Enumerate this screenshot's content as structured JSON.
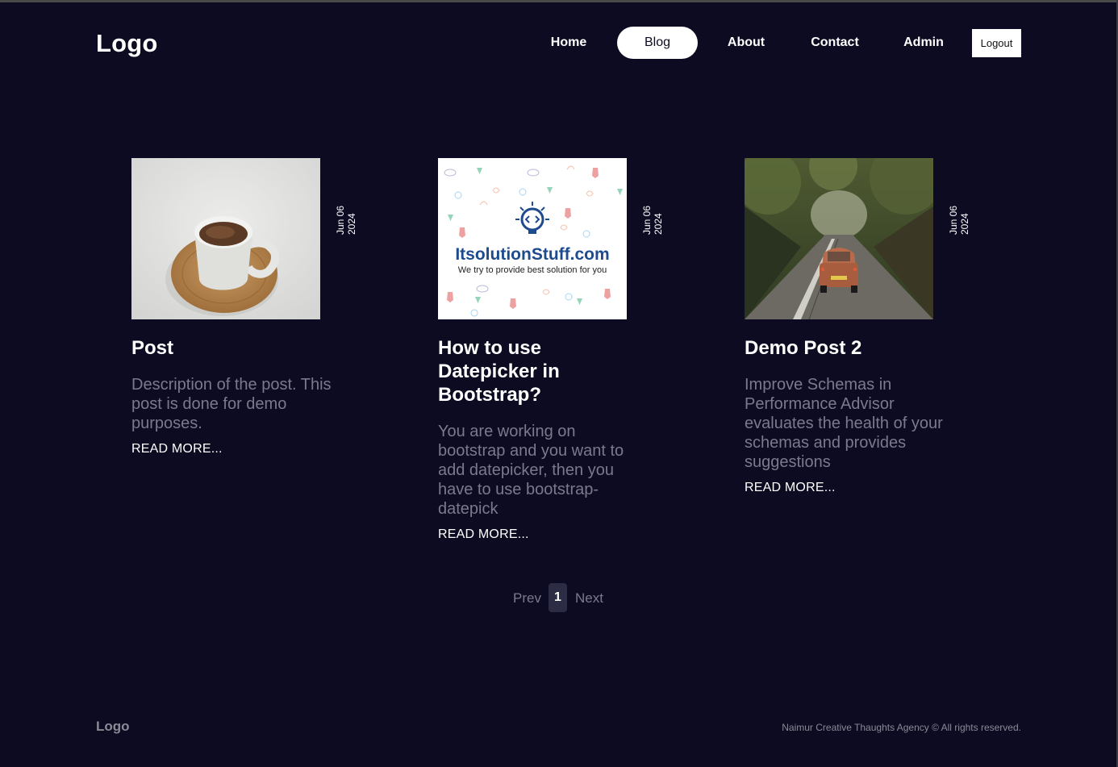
{
  "header": {
    "logo": "Logo",
    "nav": [
      {
        "label": "Home",
        "active": false
      },
      {
        "label": "Blog",
        "active": true
      },
      {
        "label": "About",
        "active": false
      },
      {
        "label": "Contact",
        "active": false
      },
      {
        "label": "Admin",
        "active": false
      }
    ],
    "logout_label": "Logout"
  },
  "posts": [
    {
      "title": "Post",
      "date_month_day": "Jun 06",
      "date_year": "2024",
      "description": "Description of the post. This post is done for demo purposes.",
      "read_more": "READ MORE...",
      "image": "coffee-cup-photo"
    },
    {
      "title": "How to use Datepicker in Bootstrap?",
      "date_month_day": "Jun 06",
      "date_year": "2024",
      "description": "You are working on bootstrap and you want to add datepicker, then you have to use bootstrap-datepick",
      "read_more": "READ MORE...",
      "image": "itsolutionstuff-logo",
      "image_text": {
        "brand": "ItsolutionStuff.com",
        "tagline": "We try to provide best solution for you"
      }
    },
    {
      "title": "Demo Post 2",
      "date_month_day": "Jun 06",
      "date_year": "2024",
      "description": "Improve Schemas in Performance Advisor evaluates the health of your schemas and provides suggestions",
      "read_more": "READ MORE...",
      "image": "vintage-car-road-photo"
    }
  ],
  "pagination": {
    "prev": "Prev",
    "current": "1",
    "next": "Next"
  },
  "footer": {
    "logo": "Logo",
    "copyright": "Naimur Creative Thaughts Agency © All rights reserved."
  },
  "colors": {
    "background": "#0c0b22",
    "muted_text": "#7b7a8c",
    "active_nav_bg": "#ffffff"
  }
}
